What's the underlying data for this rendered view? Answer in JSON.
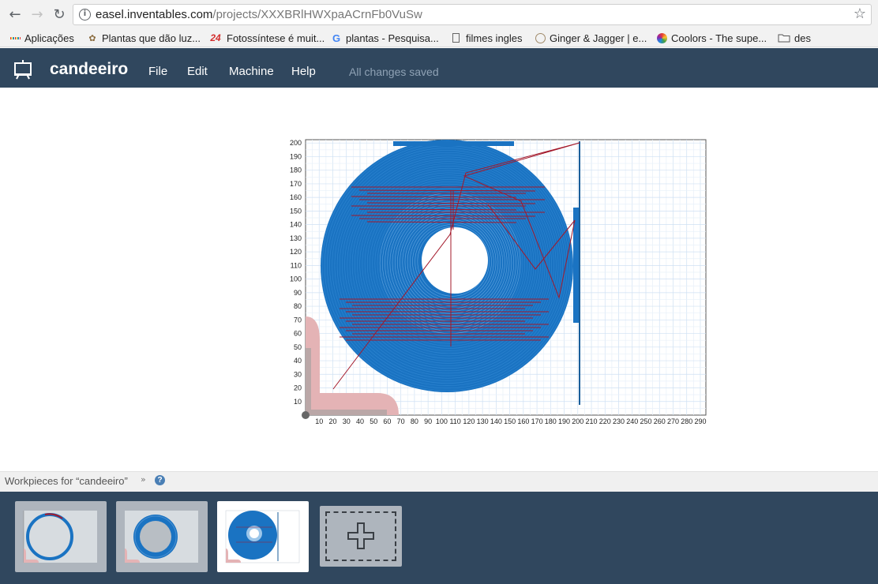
{
  "browser": {
    "url_domain": "easel.inventables.com",
    "url_path": "/projects/XXXBRlHWXpaACrnFb0VuSw",
    "nav": {
      "back_icon": "arrow-left-icon",
      "forward_icon": "arrow-right-icon",
      "reload_icon": "reload-icon"
    },
    "bookmarks": [
      {
        "label": "Aplicações",
        "icon": "apps-grid-icon"
      },
      {
        "label": "Plantas que dão luz...",
        "icon": "plant-icon"
      },
      {
        "label": "Fotossíntese é muit...",
        "icon": "site-24-icon"
      },
      {
        "label": "plantas - Pesquisa...",
        "icon": "google-icon"
      },
      {
        "label": "filmes ingles",
        "icon": "document-icon"
      },
      {
        "label": "Ginger & Jagger | e...",
        "icon": "circle-logo-icon"
      },
      {
        "label": "Coolors - The supe...",
        "icon": "coolors-icon"
      },
      {
        "label": "des",
        "icon": "folder-icon"
      }
    ]
  },
  "app": {
    "title": "candeeiro",
    "menu": [
      "File",
      "Edit",
      "Machine",
      "Help"
    ],
    "status": "All changes saved",
    "colors": {
      "header": "#30475e",
      "toolpath": "#1a73c2",
      "travel": "#a3182a",
      "origin_marker": "#e4b3b5"
    }
  },
  "plot": {
    "x_ticks": [
      "10",
      "20",
      "30",
      "40",
      "50",
      "60",
      "70",
      "80",
      "90",
      "100",
      "110",
      "120",
      "130",
      "140",
      "150",
      "160",
      "170",
      "180",
      "190",
      "200",
      "210",
      "220",
      "230",
      "240",
      "250",
      "260",
      "270",
      "280",
      "290"
    ],
    "y_ticks": [
      "10",
      "20",
      "30",
      "40",
      "50",
      "60",
      "70",
      "80",
      "90",
      "100",
      "110",
      "120",
      "130",
      "140",
      "150",
      "160",
      "170",
      "180",
      "190",
      "200"
    ]
  },
  "workpieces": {
    "label": "Workpieces for “candeeiro”",
    "chevron_icon": "double-chevron-down-icon",
    "help_icon": "question-icon",
    "add_icon": "plus-icon",
    "thumbnails": [
      {
        "name": "workpiece-1",
        "active": false
      },
      {
        "name": "workpiece-2",
        "active": false
      },
      {
        "name": "workpiece-3",
        "active": true
      }
    ]
  }
}
